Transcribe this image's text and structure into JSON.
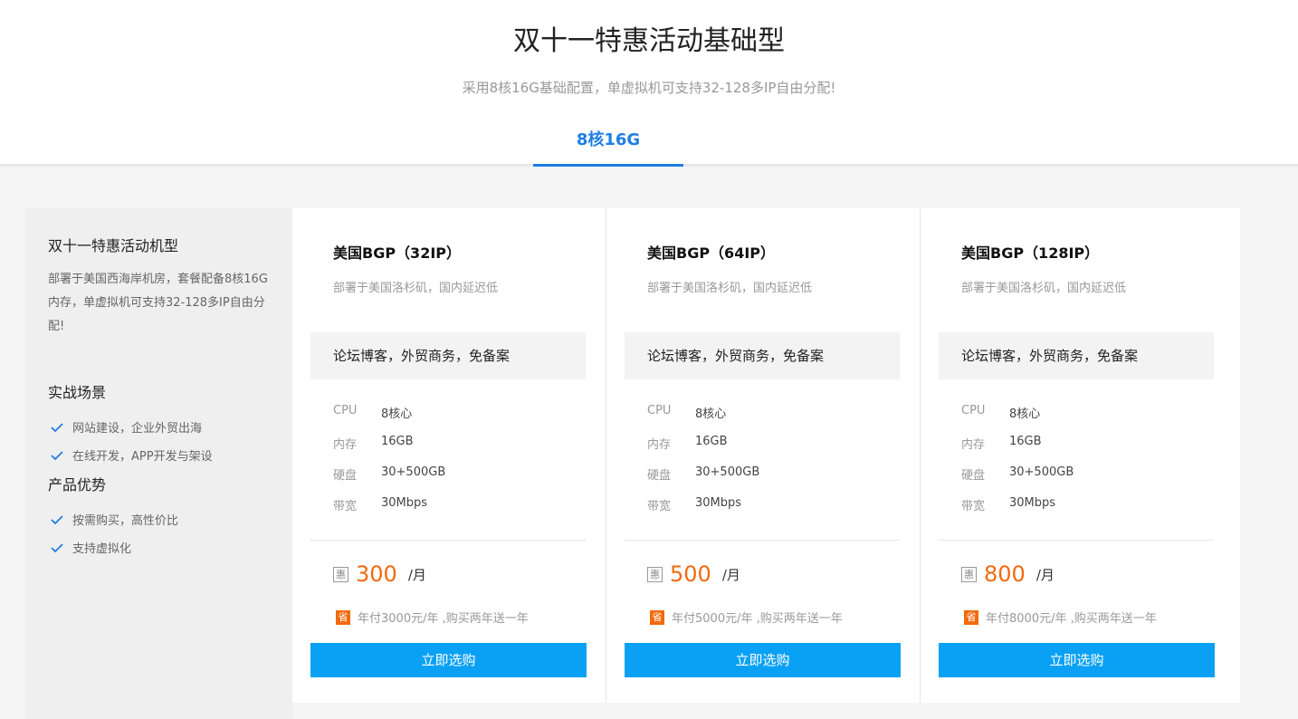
{
  "header": {
    "title": "双十一特惠活动基础型",
    "subtitle": "采用8核16G基础配置，单虚拟机可支持32-128多IP自由分配!",
    "tab": "8核16G"
  },
  "side": {
    "title": "双十一特惠活动机型",
    "desc": "部署于美国西海岸机房，套餐配备8核16G内存，单虚拟机可支持32-128多IP自由分配!",
    "scenes_title": "实战场景",
    "scenes": [
      "网站建设，企业外贸出海",
      "在线开发，APP开发与架设"
    ],
    "adv_title": "产品优势",
    "advantages": [
      "按需购买，高性价比",
      "支持虚拟化"
    ]
  },
  "colors": {
    "accent": "#1e7ee6",
    "button": "#0aa1f5",
    "price": "#f26a0e"
  },
  "icons": {
    "check": "check-icon",
    "discount": "hui-badge-icon",
    "save": "sheng-badge-icon"
  },
  "cards": [
    {
      "name": "美国BGP（32IP）",
      "location": "部署于美国洛杉矶，国内延迟低",
      "tag": "论坛博客，外贸商务，免备案",
      "specs": [
        {
          "k": "CPU",
          "v": "8核心"
        },
        {
          "k": "内存",
          "v": "16GB"
        },
        {
          "k": "硬盘",
          "v": "30+500GB"
        },
        {
          "k": "带宽",
          "v": "30Mbps"
        }
      ],
      "hui": "惠",
      "price": "300",
      "unit": "/月",
      "sheng": "省",
      "yearly": "年付3000元/年 ,购买两年送一年",
      "buy": "立即选购"
    },
    {
      "name": "美国BGP（64IP）",
      "location": "部署于美国洛杉矶，国内延迟低",
      "tag": "论坛博客，外贸商务，免备案",
      "specs": [
        {
          "k": "CPU",
          "v": "8核心"
        },
        {
          "k": "内存",
          "v": "16GB"
        },
        {
          "k": "硬盘",
          "v": "30+500GB"
        },
        {
          "k": "带宽",
          "v": "30Mbps"
        }
      ],
      "hui": "惠",
      "price": "500",
      "unit": "/月",
      "sheng": "省",
      "yearly": "年付5000元/年 ,购买两年送一年",
      "buy": "立即选购"
    },
    {
      "name": "美国BGP（128IP）",
      "location": "部署于美国洛杉矶，国内延迟低",
      "tag": "论坛博客，外贸商务，免备案",
      "specs": [
        {
          "k": "CPU",
          "v": "8核心"
        },
        {
          "k": "内存",
          "v": "16GB"
        },
        {
          "k": "硬盘",
          "v": "30+500GB"
        },
        {
          "k": "带宽",
          "v": "30Mbps"
        }
      ],
      "hui": "惠",
      "price": "800",
      "unit": "/月",
      "sheng": "省",
      "yearly": "年付8000元/年 ,购买两年送一年",
      "buy": "立即选购"
    }
  ]
}
